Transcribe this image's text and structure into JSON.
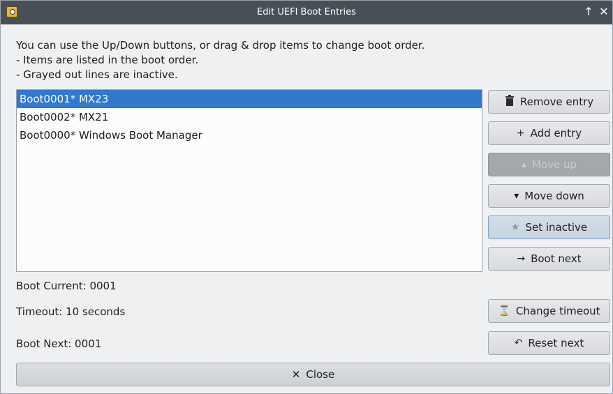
{
  "window": {
    "title": "Edit UEFI Boot Entries",
    "keep_above_icon": "↑",
    "close_icon": "✕"
  },
  "info": {
    "line1": "You can use the Up/Down buttons, or drag & drop items to change boot order.",
    "line2": "- Items are listed in the boot order.",
    "line3": "- Grayed out lines are inactive."
  },
  "boot_entries": [
    {
      "label": "Boot0001* MX23",
      "selected": true
    },
    {
      "label": "Boot0002* MX21",
      "selected": false
    },
    {
      "label": "Boot0000* Windows Boot Manager",
      "selected": false
    }
  ],
  "buttons": {
    "remove": {
      "icon": "trash-icon",
      "label": "Remove entry"
    },
    "add": {
      "icon": "plus-icon",
      "label": "Add entry"
    },
    "move_up": {
      "icon": "arrow-up-icon",
      "label": "Move up",
      "enabled": false
    },
    "move_down": {
      "icon": "arrow-down-icon",
      "label": "Move down"
    },
    "set_inactive": {
      "icon": "star-icon",
      "label": "Set inactive"
    },
    "boot_next": {
      "icon": "arrow-right-icon",
      "label": "Boot next"
    },
    "change_timeout": {
      "icon": "hourglass-icon",
      "label": "Change timeout"
    },
    "reset_next": {
      "icon": "undo-icon",
      "label": "Reset next"
    },
    "close": {
      "icon": "close-icon",
      "label": "Close"
    }
  },
  "status": {
    "boot_current": "Boot Current: 0001",
    "timeout": "Timeout: 10 seconds",
    "boot_next": "Boot Next: 0001"
  },
  "colors": {
    "titlebar": "#475057",
    "selection": "#3178cf",
    "window_bg": "#eff0f1"
  }
}
